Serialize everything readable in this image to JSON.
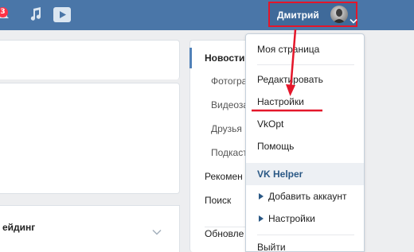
{
  "header": {
    "notifications_count": "3",
    "user_name": "Дмитрий"
  },
  "sidebar_left": {
    "rating_label": "ейдинг"
  },
  "nav": {
    "items": [
      {
        "label": "Новости"
      },
      {
        "label": "Фотогра"
      },
      {
        "label": "Видеоза"
      },
      {
        "label": "Друзья"
      },
      {
        "label": "Подкаст"
      },
      {
        "label": "Рекомен"
      },
      {
        "label": "Поиск"
      },
      {
        "label": "Обновле"
      }
    ]
  },
  "dropdown": {
    "items": [
      {
        "label": "Моя страница"
      },
      {
        "label": "Редактировать"
      },
      {
        "label": "Настройки"
      },
      {
        "label": "VkOpt"
      },
      {
        "label": "Помощь"
      },
      {
        "label": "VK Helper"
      },
      {
        "label": "Добавить аккаунт"
      },
      {
        "label": "Настройки"
      },
      {
        "label": "Выйти"
      }
    ]
  },
  "colors": {
    "header_bg": "#4a76a8",
    "highlight_red": "#e4162a",
    "link_blue": "#2a5885"
  },
  "icons": [
    "bell-icon",
    "music-icon",
    "play-icon",
    "chevron-down-icon",
    "triangle-right-icon"
  ]
}
